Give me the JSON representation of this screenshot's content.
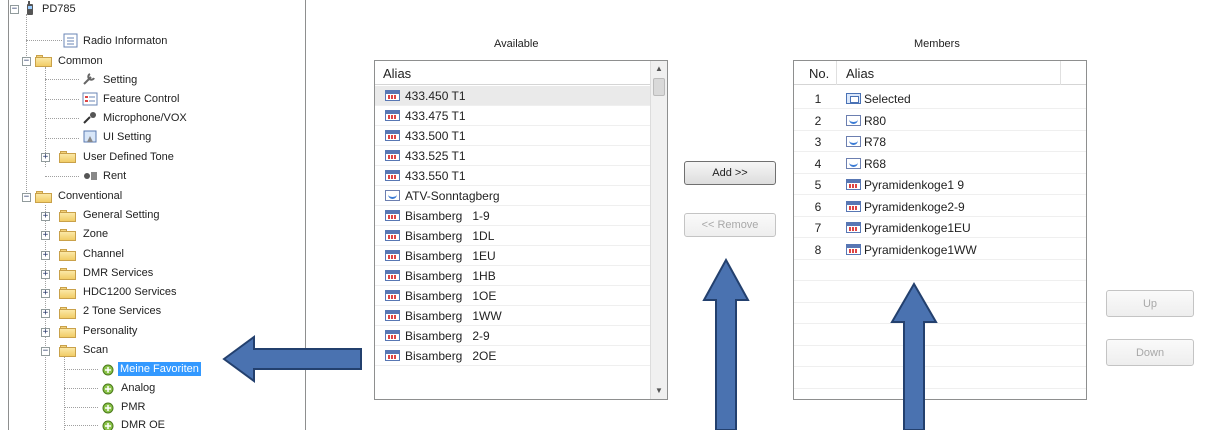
{
  "tree": {
    "root": "PD785",
    "items": [
      {
        "label": "Radio Informaton"
      },
      {
        "label": "Common"
      },
      {
        "label": "Setting"
      },
      {
        "label": "Feature Control"
      },
      {
        "label": "Microphone/VOX"
      },
      {
        "label": "UI Setting"
      },
      {
        "label": "User Defined Tone"
      },
      {
        "label": "Rent"
      },
      {
        "label": "Conventional"
      },
      {
        "label": "General Setting"
      },
      {
        "label": "Zone"
      },
      {
        "label": "Channel"
      },
      {
        "label": "DMR Services"
      },
      {
        "label": "HDC1200 Services"
      },
      {
        "label": "2 Tone Services"
      },
      {
        "label": "Personality"
      },
      {
        "label": "Scan"
      },
      {
        "label": "Meine Favoriten"
      },
      {
        "label": "Analog"
      },
      {
        "label": "PMR"
      },
      {
        "label": "DMR OE"
      }
    ]
  },
  "available": {
    "header": "Available",
    "column": "Alias",
    "rows": [
      {
        "alias": "433.450 T1",
        "icon": "digital-channel-icon"
      },
      {
        "alias": "433.475 T1",
        "icon": "digital-channel-icon"
      },
      {
        "alias": "433.500 T1",
        "icon": "digital-channel-icon"
      },
      {
        "alias": "433.525 T1",
        "icon": "digital-channel-icon"
      },
      {
        "alias": "433.550 T1",
        "icon": "digital-channel-icon"
      },
      {
        "alias": "ATV-Sonntagberg",
        "icon": "analog-channel-icon"
      },
      {
        "alias": "Bisamberg   1-9",
        "icon": "digital-channel-icon"
      },
      {
        "alias": "Bisamberg   1DL",
        "icon": "digital-channel-icon"
      },
      {
        "alias": "Bisamberg   1EU",
        "icon": "digital-channel-icon"
      },
      {
        "alias": "Bisamberg   1HB",
        "icon": "digital-channel-icon"
      },
      {
        "alias": "Bisamberg   1OE",
        "icon": "digital-channel-icon"
      },
      {
        "alias": "Bisamberg   1WW",
        "icon": "digital-channel-icon"
      },
      {
        "alias": "Bisamberg   2-9",
        "icon": "digital-channel-icon"
      },
      {
        "alias": "Bisamberg   2OE",
        "icon": "digital-channel-icon"
      }
    ]
  },
  "buttons": {
    "add": "Add >>",
    "remove": "<< Remove",
    "up": "Up",
    "down": "Down"
  },
  "members": {
    "header": "Members",
    "col_no": "No.",
    "col_alias": "Alias",
    "rows": [
      {
        "no": "1",
        "alias": "Selected",
        "icon": "group-icon"
      },
      {
        "no": "2",
        "alias": "R80",
        "icon": "analog-channel-icon"
      },
      {
        "no": "3",
        "alias": "R78",
        "icon": "analog-channel-icon"
      },
      {
        "no": "4",
        "alias": "R68",
        "icon": "analog-channel-icon"
      },
      {
        "no": "5",
        "alias": "Pyramidenkoge1 9",
        "icon": "digital-channel-icon"
      },
      {
        "no": "6",
        "alias": "Pyramidenkoge2-9",
        "icon": "digital-channel-icon"
      },
      {
        "no": "7",
        "alias": "Pyramidenkoge1EU",
        "icon": "digital-channel-icon"
      },
      {
        "no": "8",
        "alias": "Pyramidenkoge1WW",
        "icon": "digital-channel-icon"
      }
    ]
  },
  "annotation_color": "#4a72b0"
}
